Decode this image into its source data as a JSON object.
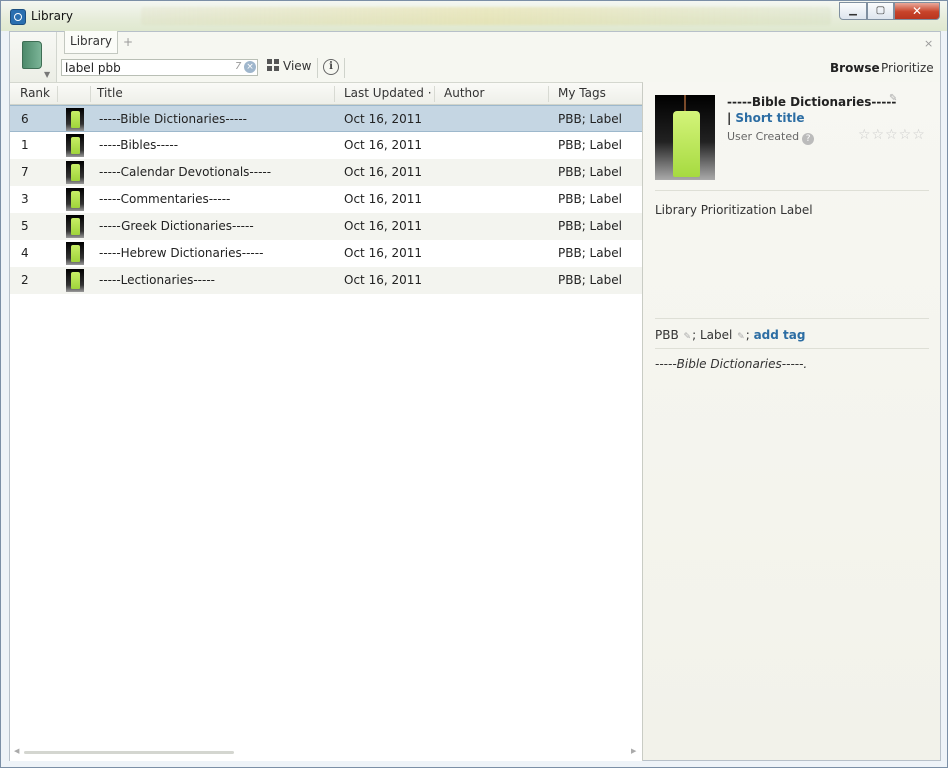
{
  "window": {
    "title": "Library",
    "controls": {
      "minimize": "▁",
      "maximize": "▢",
      "close": "✕"
    }
  },
  "panel": {
    "tab_label": "Library",
    "tab_add": "+",
    "close": "×",
    "icon": "book-icon"
  },
  "toolbar": {
    "search_value": "label pbb",
    "result_count": "7",
    "clear": "×",
    "view_label": "View",
    "info_label": "i",
    "browse_label": "Browse",
    "prioritize_label": "Prioritize"
  },
  "table": {
    "columns": {
      "rank": "Rank",
      "title": "Title",
      "last_updated": "Last Updated",
      "sort_indicator": "·",
      "author": "Author",
      "my_tags": "My Tags"
    },
    "rows": [
      {
        "rank": "6",
        "title": "-----Bible Dictionaries-----",
        "last_updated": "Oct 16, 2011",
        "author": "",
        "my_tags": "PBB; Label",
        "selected": true
      },
      {
        "rank": "1",
        "title": "-----Bibles-----",
        "last_updated": "Oct 16, 2011",
        "author": "",
        "my_tags": "PBB; Label"
      },
      {
        "rank": "7",
        "title": "-----Calendar Devotionals-----",
        "last_updated": "Oct 16, 2011",
        "author": "",
        "my_tags": "PBB; Label"
      },
      {
        "rank": "3",
        "title": "-----Commentaries-----",
        "last_updated": "Oct 16, 2011",
        "author": "",
        "my_tags": "PBB; Label"
      },
      {
        "rank": "5",
        "title": "-----Greek Dictionaries-----",
        "last_updated": "Oct 16, 2011",
        "author": "",
        "my_tags": "PBB; Label"
      },
      {
        "rank": "4",
        "title": "-----Hebrew Dictionaries-----",
        "last_updated": "Oct 16, 2011",
        "author": "",
        "my_tags": "PBB; Label"
      },
      {
        "rank": "2",
        "title": "-----Lectionaries-----",
        "last_updated": "Oct 16, 2011",
        "author": "",
        "my_tags": "PBB; Label"
      }
    ]
  },
  "detail": {
    "title": "-----Bible Dictionaries-----",
    "short_title_bar": "|",
    "short_title": "Short title",
    "user_created": "User Created",
    "help": "?",
    "stars": "☆☆☆☆☆",
    "edit_icon": "✎",
    "description": "Library Prioritization Label",
    "tag1": "PBB",
    "tag_sep": "; ",
    "tag2": "Label",
    "tag_end": ";",
    "add_tag": "add tag",
    "note": "-----Bible Dictionaries-----."
  }
}
